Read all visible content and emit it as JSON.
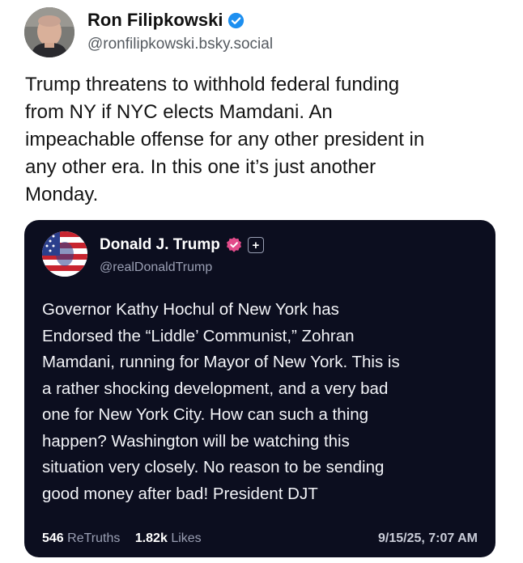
{
  "post": {
    "author": {
      "display_name": "Ron Filipkowski",
      "handle": "@ronfilipkowski.bsky.social",
      "verified_icon": "verified-check-icon",
      "verified_color": "#1d8ff0"
    },
    "text_lines": [
      "Trump threatens to withhold federal funding",
      "from NY if NYC elects Mamdani. An",
      "impeachable offense for any other president in",
      "any other era. In this one it’s just another",
      "Monday."
    ]
  },
  "quoted": {
    "author": {
      "display_name": "Donald J. Trump",
      "handle": "@realDonaldTrump",
      "badge_icon": "verified-badge-icon",
      "badge_color": "#e24b8a",
      "plus_badge": "+"
    },
    "text_lines": [
      "Governor Kathy Hochul of New York has",
      "Endorsed the “Liddle’ Communist,” Zohran",
      "Mamdani, running for Mayor of New York. This is",
      "a rather shocking development, and a very bad",
      "one for New York City. How can such a thing",
      "happen? Washington will be watching this",
      "situation very closely. No reason to be sending",
      "good money after bad! President DJT"
    ],
    "stats": {
      "retruths_count": "546",
      "retruths_label": "ReTruths",
      "likes_count": "1.82k",
      "likes_label": "Likes"
    },
    "timestamp": "9/15/25, 7:07 AM",
    "background": "#0c0e1f"
  }
}
